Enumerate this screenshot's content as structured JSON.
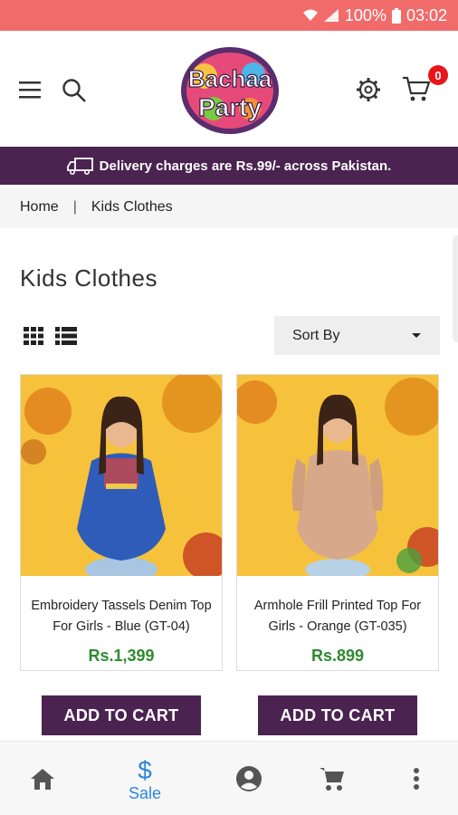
{
  "status_bar": {
    "battery": "100%",
    "time": "03:02"
  },
  "header": {
    "logo_line1": "Bachaa",
    "logo_line2": "Party",
    "cart_count": "0"
  },
  "banner": {
    "text": "Delivery charges are Rs.99/- across Pakistan."
  },
  "breadcrumb": {
    "home": "Home",
    "separator": "|",
    "current": "Kids Clothes"
  },
  "page": {
    "title": "Kids Clothes"
  },
  "sort": {
    "label": "Sort By"
  },
  "products": [
    {
      "name": "Embroidery Tassels Denim Top For Girls - Blue (GT-04)",
      "price": "Rs.1,399",
      "color": "#2f5cb8"
    },
    {
      "name": "Armhole Frill Printed Top For Girls - Orange (GT-035)",
      "price": "Rs.899",
      "color": "#d7a98a"
    }
  ],
  "add_to_cart_label": "ADD TO CART",
  "bottom_nav": {
    "items": [
      {
        "icon": "home-icon",
        "label": ""
      },
      {
        "icon": "dollar-icon",
        "label": "Sale",
        "active": true
      },
      {
        "icon": "account-icon",
        "label": ""
      },
      {
        "icon": "cart-icon",
        "label": ""
      },
      {
        "icon": "more-vert-icon",
        "label": ""
      }
    ]
  },
  "colors": {
    "status_bar": "#f26b6b",
    "brand": "#4a2350",
    "price": "#2e8b2e",
    "active_nav": "#2e86de"
  }
}
